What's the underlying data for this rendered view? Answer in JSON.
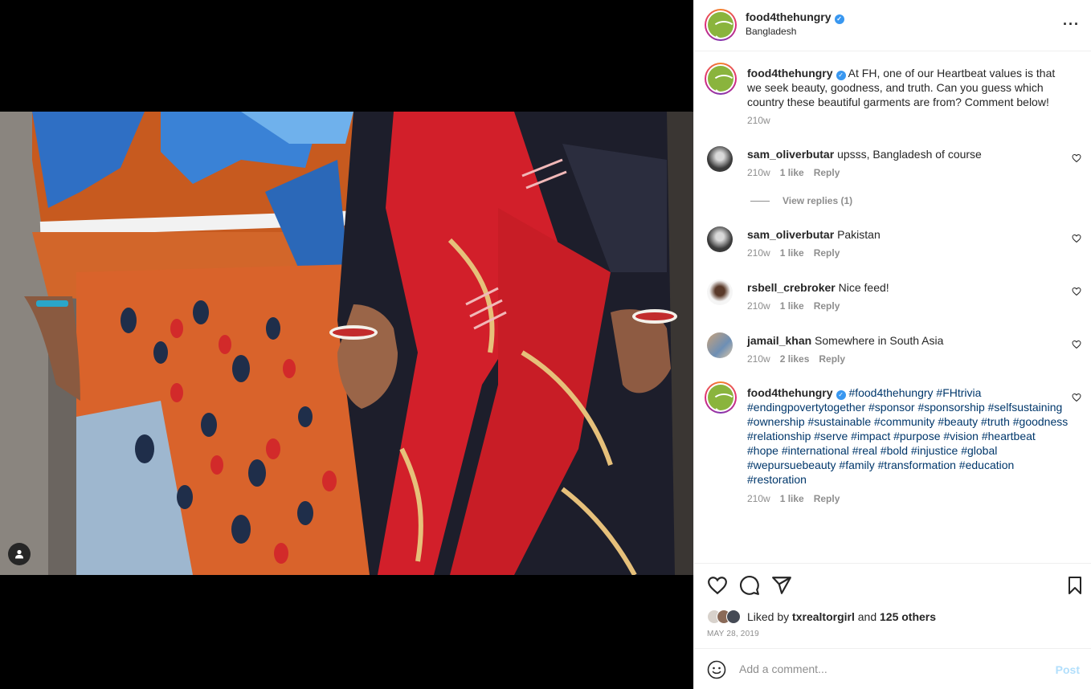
{
  "post": {
    "username": "food4thehungry",
    "location": "Bangladesh",
    "verified_icon": "verified-badge-icon"
  },
  "caption": {
    "username": "food4thehungry",
    "text": "At FH, one of our Heartbeat values is that we seek beauty, goodness, and truth. Can you guess which country these beautiful garments are from? Comment below!",
    "time": "210w"
  },
  "comments": [
    {
      "username": "sam_oliverbutar",
      "text": "upsss, Bangladesh of course",
      "time": "210w",
      "likes": "1 like",
      "reply": "Reply",
      "view_replies": "View replies (1)"
    },
    {
      "username": "sam_oliverbutar",
      "text": "Pakistan",
      "time": "210w",
      "likes": "1 like",
      "reply": "Reply"
    },
    {
      "username": "rsbell_crebroker",
      "text": "Nice feed!",
      "time": "210w",
      "likes": "1 like",
      "reply": "Reply"
    },
    {
      "username": "jamail_khan",
      "text": "Somewhere in South Asia",
      "time": "210w",
      "likes": "2 likes",
      "reply": "Reply"
    }
  ],
  "hashtag_comment": {
    "username": "food4thehungry",
    "tags": "#food4thehungry #FHtrivia #endingpovertytogether #sponsor #sponsorship #selfsustaining #ownership #sustainable #community #beauty #truth #goodness #relationship #serve #impact #purpose #vision #heartbeat #hope #international #real #bold #injustice #global #wepursuebeauty #family #transformation #education #restoration",
    "time": "210w",
    "likes": "1 like",
    "reply": "Reply"
  },
  "likes": {
    "prefix": "Liked by",
    "user": "txrealtorgirl",
    "and": "and",
    "others": "125 others"
  },
  "date": "MAY 28, 2019",
  "add_comment": {
    "placeholder": "Add a comment...",
    "post_label": "Post"
  },
  "colors": {
    "accent_link": "#00376b",
    "verified": "#3897f0",
    "muted": "#8e8e8e",
    "post_disabled": "#b2dffc",
    "brand_green": "#8ab43d"
  }
}
